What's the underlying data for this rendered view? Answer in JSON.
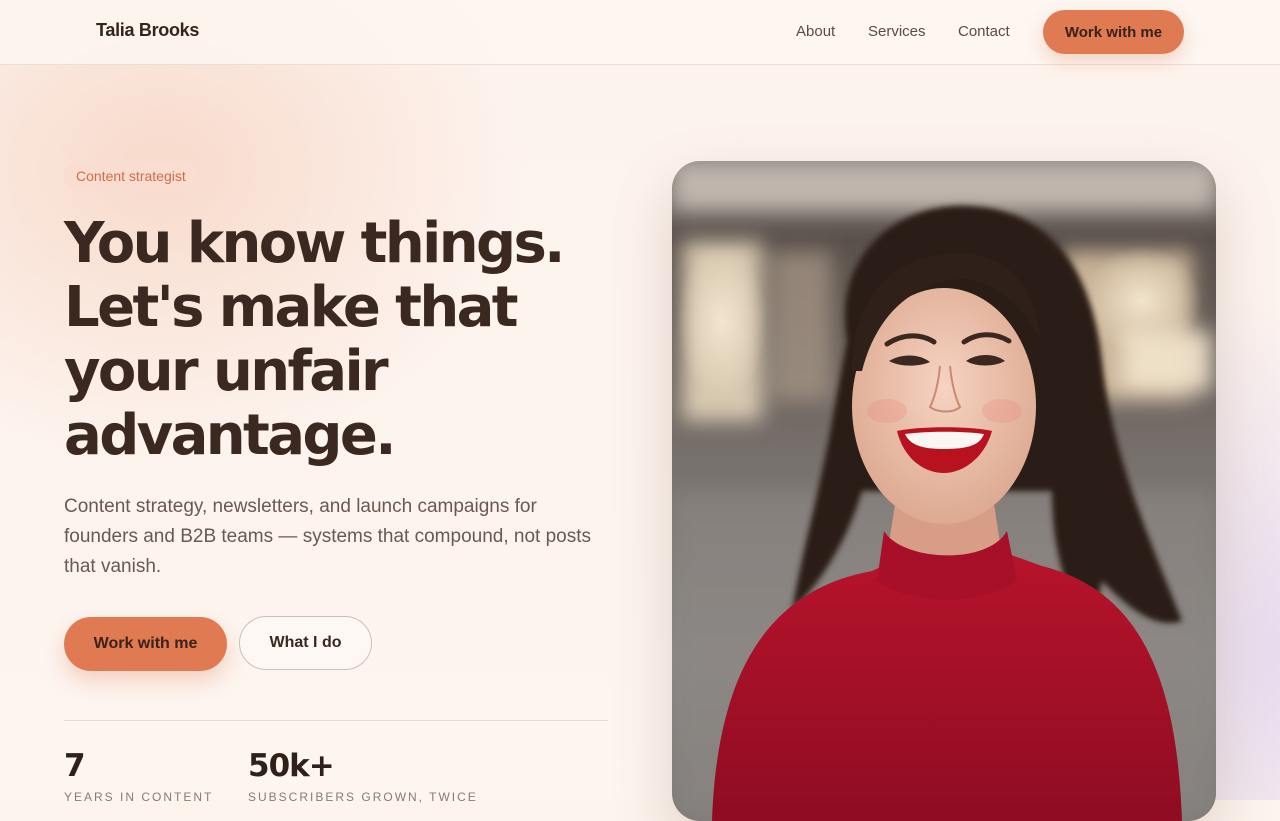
{
  "header": {
    "brand": "Talia Brooks",
    "nav": [
      "About",
      "Services",
      "Contact"
    ],
    "cta": "Work with me"
  },
  "hero": {
    "eyebrow": "Content strategist",
    "headline": "You know things. Let's make that your unfair advantage.",
    "subheadline": "Content strategy, newsletters, and launch campaigns for founders and B2B teams — systems that compound, not posts that vanish.",
    "primary_cta": "Work with me",
    "secondary_cta": "What I do",
    "stats": [
      {
        "value": "7",
        "label": "YEARS IN CONTENT"
      },
      {
        "value": "50k+",
        "label": "SUBSCRIBERS GROWN, TWICE"
      }
    ],
    "photo_icon": "portrait-photo"
  },
  "colors": {
    "accent": "#e07a52",
    "text_dark": "#3b2820",
    "background": "#fdf4ee",
    "eyebrow_bg": "#f8ddd0"
  }
}
